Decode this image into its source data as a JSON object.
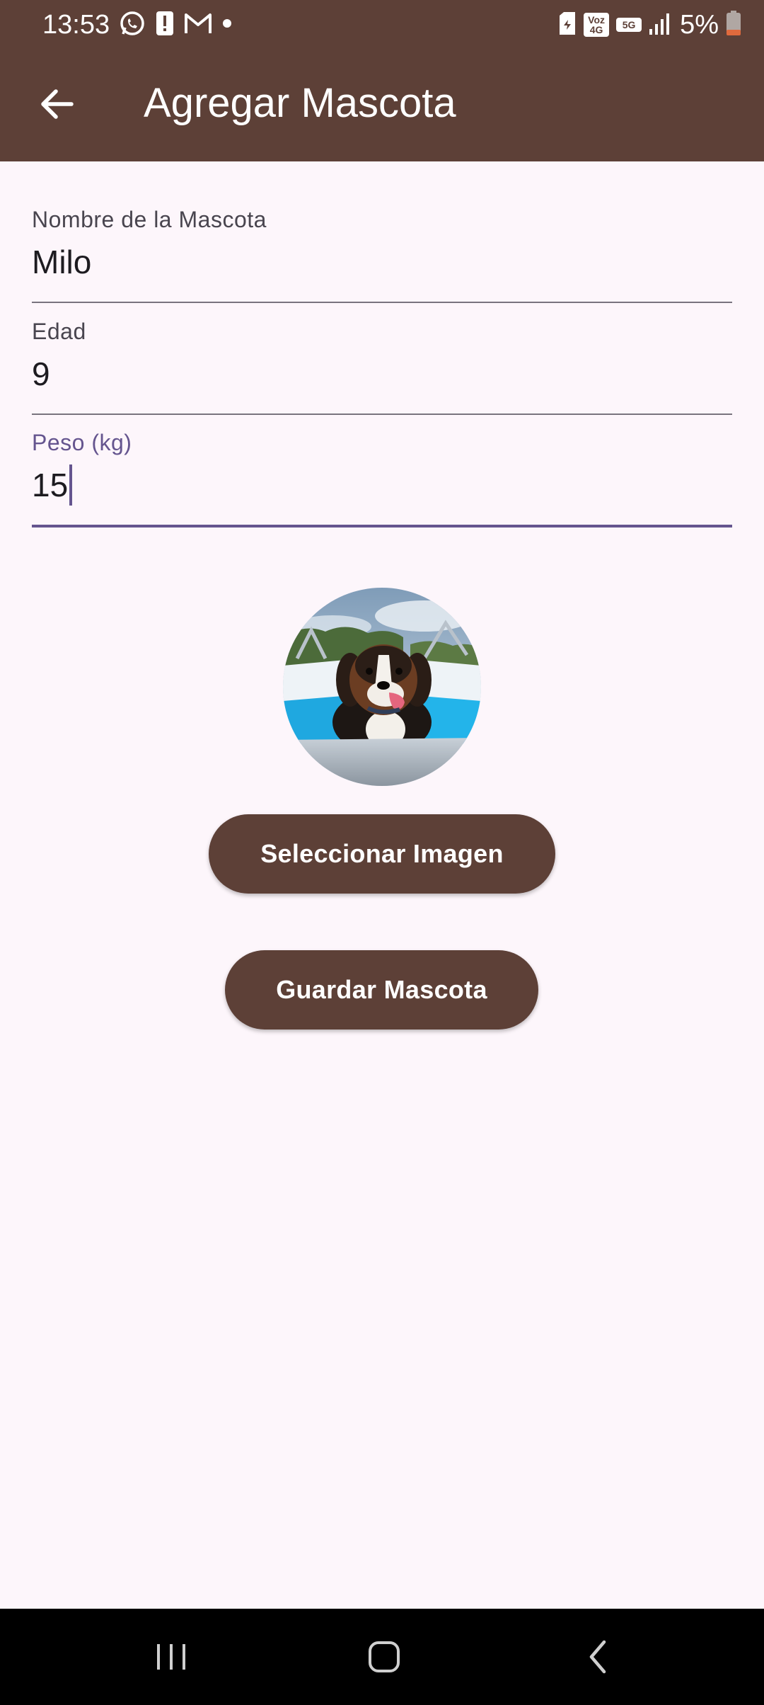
{
  "status_bar": {
    "time": "13:53",
    "battery": "5%",
    "left_icons": [
      "whatsapp-icon",
      "alert-icon",
      "gmail-icon",
      "dot-icon"
    ],
    "right_icons": [
      "sim-icon",
      "volte-icon",
      "5g-icon",
      "signal-icon",
      "battery-icon"
    ],
    "volte_label": "Voz 4G",
    "network_label": "5G"
  },
  "app_bar": {
    "title": "Agregar Mascota",
    "background": "#5d4037"
  },
  "form": {
    "name": {
      "label": "Nombre de la Mascota",
      "value": "Milo"
    },
    "age": {
      "label": "Edad",
      "value": "9"
    },
    "weight": {
      "label": "Peso (kg)",
      "value": "15",
      "focused": true
    }
  },
  "buttons": {
    "select_image": "Seleccionar Imagen",
    "save_pet": "Guardar Mascota"
  },
  "colors": {
    "primary": "#5d4037",
    "focus": "#65558f",
    "background": "#fdf6fb"
  }
}
